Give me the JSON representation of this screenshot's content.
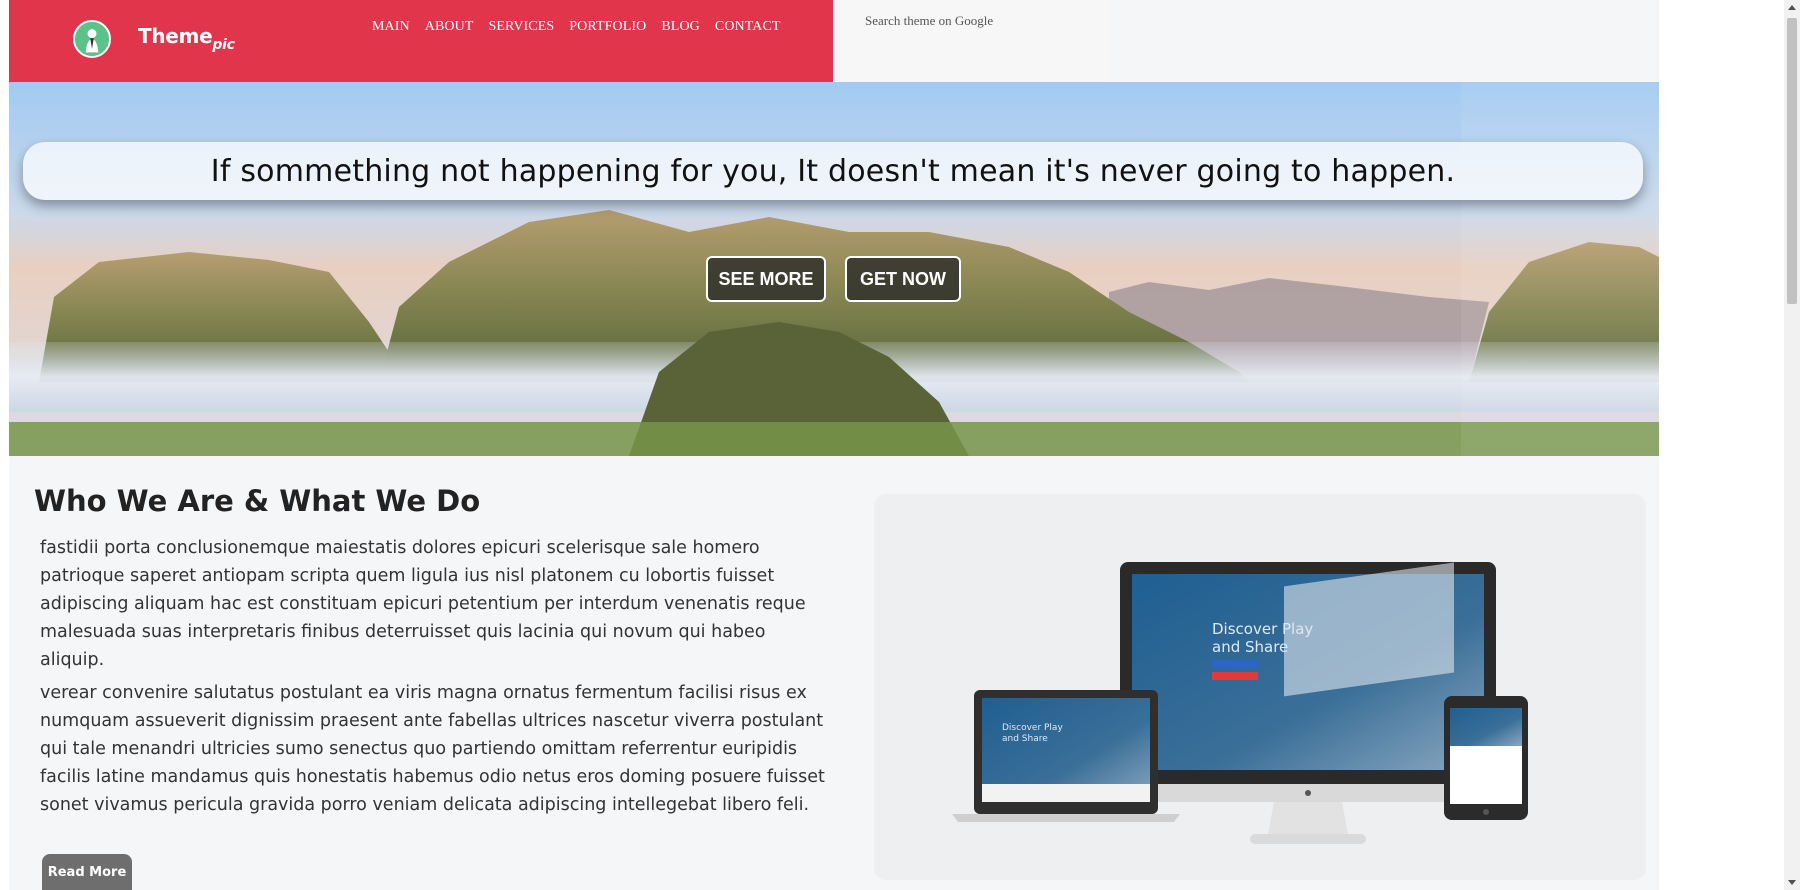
{
  "header": {
    "brand_main": "Theme",
    "brand_sub": "pic",
    "nav": [
      "MAIN",
      "ABOUT",
      "SERVICES",
      "PORTFOLIO",
      "BLOG",
      "CONTACT"
    ],
    "search_placeholder": "Search theme on Google",
    "accent_color": "#e0354a"
  },
  "hero": {
    "quote": "If sommething not happening for you, It doesn't mean it's never going to happen.",
    "see_more": "SEE MORE",
    "get_now": "GET NOW"
  },
  "about": {
    "title": "Who We Are & What We Do",
    "paragraph1": "fastidii porta conclusionemque maiestatis dolores epicuri scelerisque sale homero patrioque saperet antiopam scripta quem ligula ius nisl platonem cu lobortis fuisset adipiscing aliquam hac est constituam epicuri petentium per interdum venenatis reque malesuada suas interpretaris finibus deterruisset quis lacinia qui novum qui habeo aliquip.",
    "paragraph2": "verear convenire salutatus postulant ea viris magna ornatus fermentum facilisi risus ex numquam assueverit dignissim praesent ante fabellas ultrices nascetur viverra postulant qui tale menandri ultricies sumo senectus quo partiendo omittam referrentur euripidis facilis latine mandamus quis honestatis habemus odio netus eros doming posuere fuisset sonet vivamus pericula gravida porro veniam delicata adipiscing intellegebat libero feli.",
    "read_more": "Read More"
  },
  "devices_image": {
    "screen_text_line1": "Discover Play",
    "screen_text_line2": "and Share"
  }
}
